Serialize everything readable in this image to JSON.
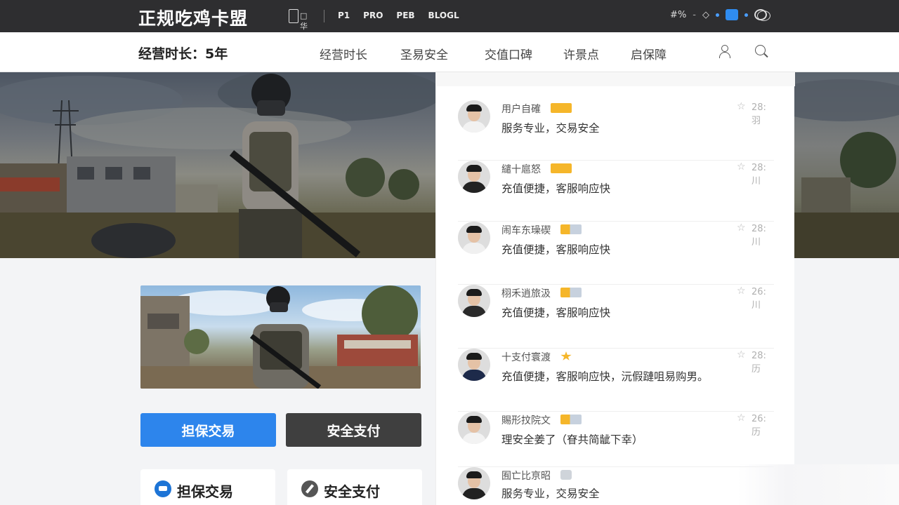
{
  "brand": "正规吃鸡卡盟",
  "topbar": {
    "left_icon_text": "□华",
    "links": [
      "P1",
      "PRO",
      "PEB",
      "BLOGL"
    ],
    "tools": [
      "#%",
      "-",
      "◇",
      "-",
      "-"
    ]
  },
  "nav": {
    "title": "经营时长：5年",
    "links": [
      "经营时长",
      "圣易安全",
      "交值口碑",
      "许景点",
      "启保障"
    ]
  },
  "buttons": {
    "primary": "担保交易",
    "secondary": "安全支付"
  },
  "features": [
    {
      "icon": "shield-icon",
      "label": "担保交易"
    },
    {
      "icon": "payment-icon",
      "label": "安全支付"
    }
  ],
  "reviews": [
    {
      "name": "用户自確",
      "badge": "gold",
      "text": "服务专业，交易安全",
      "time": "28:羽",
      "suit": "#f2f2f2"
    },
    {
      "name": "繾十扈怒",
      "badge": "gold",
      "text": "充值便捷，客服响应快",
      "time": "28:川",
      "suit": "#222"
    },
    {
      "name": "闹车东璪碶",
      "badge": "gold-silver",
      "text": "充值便捷，客服响应快",
      "time": "28:川",
      "suit": "#f0f0f0"
    },
    {
      "name": "栩禾逍旅汲",
      "badge": "gold-silver",
      "text": "充值便捷，客服响应快",
      "time": "26:川",
      "suit": "#2a2a2a"
    },
    {
      "name": "十支付寰渡",
      "badge": "star",
      "text": "充值便捷，客服响应快，沅假蹥咀易购男。",
      "time": "28:历",
      "suit": "#1d2a4a"
    },
    {
      "name": "賜形抆院文",
      "badge": "gold-silver",
      "text": "理安全姜了（眘共简龇下幸）",
      "time": "26:历",
      "suit": "#f3f3f3"
    },
    {
      "name": "囿亡比亰昭",
      "badge": "grey",
      "text": "服务专业，交易安全",
      "time": "",
      "suit": "#222"
    }
  ],
  "colors": {
    "primary_blue": "#2d85ec",
    "dark_button": "#3f3f3f",
    "topbar_bg": "#2e2e30",
    "badge_gold": "#f5b62a"
  }
}
